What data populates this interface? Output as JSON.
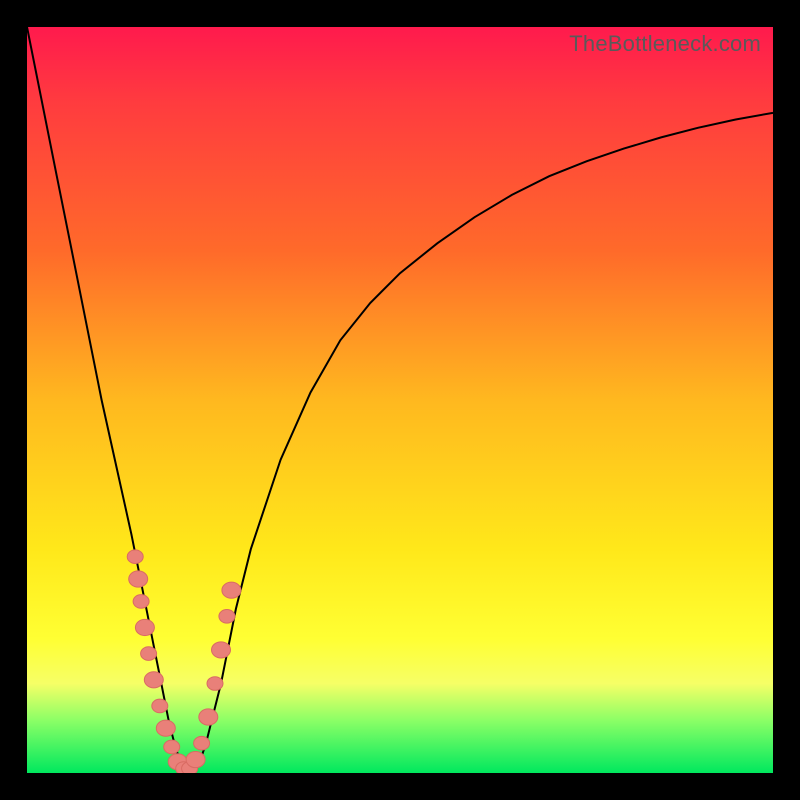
{
  "watermark": "TheBottleneck.com",
  "chart_data": {
    "type": "line",
    "title": "",
    "xlabel": "",
    "ylabel": "",
    "xlim": [
      0,
      100
    ],
    "ylim": [
      0,
      100
    ],
    "grid": false,
    "legend": false,
    "x": [
      0,
      2,
      4,
      6,
      8,
      10,
      12,
      14,
      16,
      17,
      18,
      19,
      20,
      21,
      22,
      23,
      24,
      26,
      28,
      30,
      34,
      38,
      42,
      46,
      50,
      55,
      60,
      65,
      70,
      75,
      80,
      85,
      90,
      95,
      100
    ],
    "y": [
      100,
      90,
      80,
      70,
      60,
      50,
      41,
      32,
      22,
      17,
      12,
      7,
      3,
      1,
      0,
      1,
      4,
      12,
      22,
      30,
      42,
      51,
      58,
      63,
      67,
      71,
      74.5,
      77.5,
      80,
      82,
      83.7,
      85.2,
      86.5,
      87.6,
      88.5
    ],
    "beads_left": [
      {
        "x": 14.5,
        "y": 29
      },
      {
        "x": 14.9,
        "y": 26
      },
      {
        "x": 15.3,
        "y": 23
      },
      {
        "x": 15.8,
        "y": 19.5
      },
      {
        "x": 16.3,
        "y": 16
      },
      {
        "x": 17.0,
        "y": 12.5
      },
      {
        "x": 17.8,
        "y": 9
      },
      {
        "x": 18.6,
        "y": 6
      },
      {
        "x": 19.4,
        "y": 3.5
      },
      {
        "x": 20.2,
        "y": 1.5
      },
      {
        "x": 21.0,
        "y": 0.6
      }
    ],
    "beads_right": [
      {
        "x": 21.8,
        "y": 0.6
      },
      {
        "x": 22.6,
        "y": 1.8
      },
      {
        "x": 23.4,
        "y": 4
      },
      {
        "x": 24.3,
        "y": 7.5
      },
      {
        "x": 25.2,
        "y": 12
      },
      {
        "x": 26.0,
        "y": 16.5
      },
      {
        "x": 26.8,
        "y": 21
      },
      {
        "x": 27.4,
        "y": 24.5
      }
    ],
    "colors": {
      "curve": "#000000",
      "beads": "#e98079",
      "gradient_top": "#ff1a4d",
      "gradient_bottom": "#00e85e"
    }
  }
}
